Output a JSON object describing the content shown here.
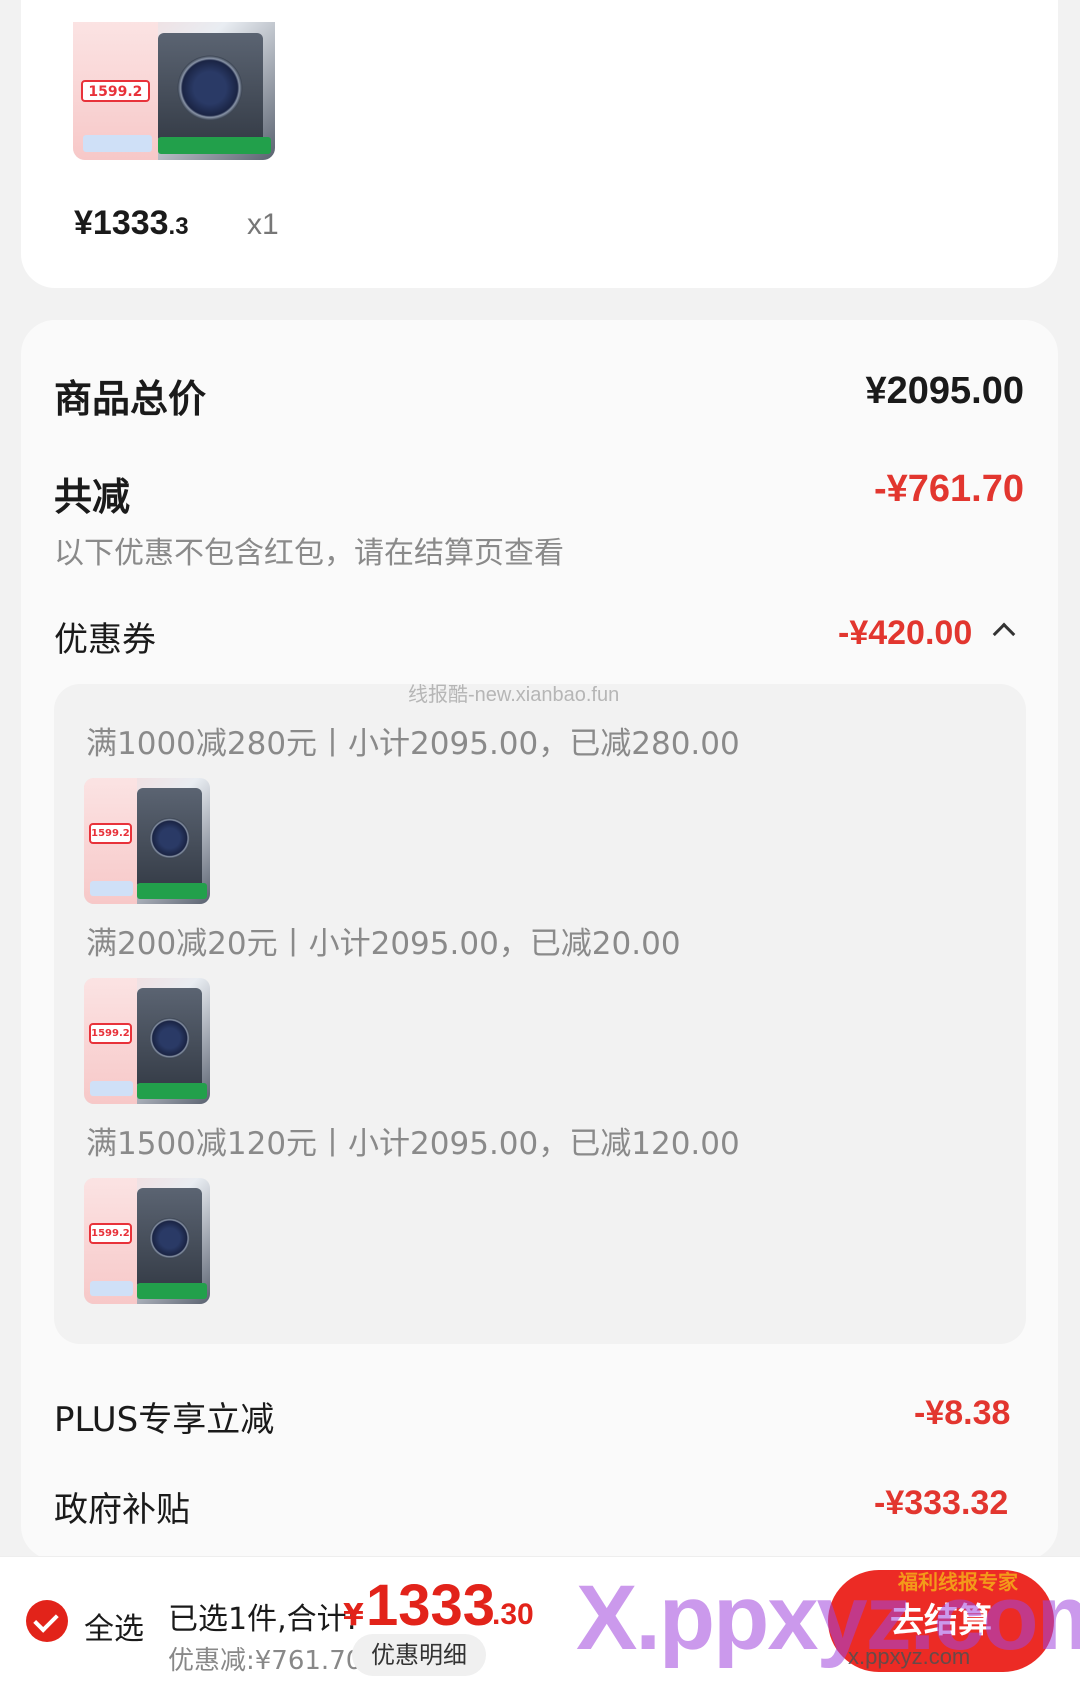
{
  "product": {
    "price_int": "¥1333",
    "price_dec": ".3",
    "quantity": "x1",
    "thumb_price": "1599.2"
  },
  "summary": {
    "total_label": "商品总价",
    "total_value": "¥2095.00",
    "discount_label": "共减",
    "discount_value": "-¥761.70",
    "discount_note": "以下优惠不包含红包，请在结算页查看",
    "coupon_label": "优惠券",
    "coupon_value": "-¥420.00",
    "watermark": "线报酷-new.xianbao.fun",
    "coupons": [
      {
        "text": "满1000减280元丨小计2095.00，已减280.00"
      },
      {
        "text": "满200减20元丨小计2095.00，已减20.00"
      },
      {
        "text": "满1500减120元丨小计2095.00，已减120.00"
      }
    ],
    "plus_label": "PLUS专享立减",
    "plus_value": "-¥8.38",
    "gov_label": "政府补贴",
    "gov_value": "-¥333.32"
  },
  "bottom": {
    "select_all": "全选",
    "selected_text": "已选1件,合计:",
    "currency": "¥",
    "total_int": "1333",
    "total_dec": ".30",
    "discount_text": "优惠减:¥761.70",
    "detail_button": "优惠明细",
    "checkout_button": "去结算",
    "watermark_big": "X.ppxyz.com",
    "watermark_small": "x.ppxyz.com",
    "watermark_badge": "福利线报专家"
  },
  "colors": {
    "accent_red": "#e2362f",
    "checkout_red": "#ec2b25"
  }
}
